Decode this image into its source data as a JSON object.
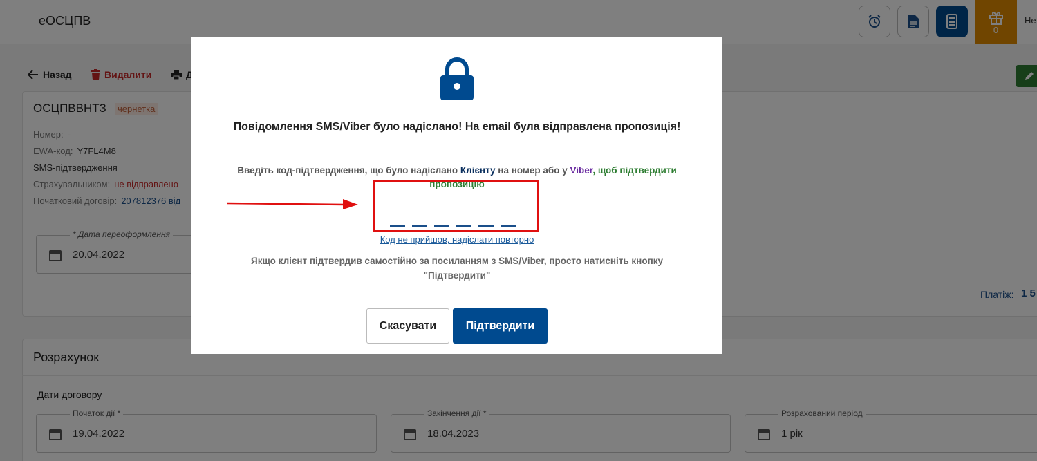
{
  "header": {
    "app_title": "еОСЦПВ",
    "gift_count": "0",
    "user_text": "Не"
  },
  "toolbar": {
    "back": "Назад",
    "delete": "Видалити",
    "print": "Д"
  },
  "document": {
    "title": "ОСЦПВВНТЗ",
    "status": "чернетка",
    "number_label": "Номер:",
    "number_value": "-",
    "ewa_label": "EWA-код:",
    "ewa_value": "Y7FL4M8",
    "sms_label": "SMS-підтвердження",
    "insurer_label": "Страхувальником:",
    "insurer_value": "не відправлено",
    "original_label": "Початковий договір:",
    "original_value": "207812376 від"
  },
  "reissue": {
    "label": "* Дата переоформлення",
    "value": "20.04.2022"
  },
  "payment": {
    "label": "Платіж:",
    "value": "1 5"
  },
  "calculation": {
    "title": "Розрахунок",
    "dates_label": "Дати договору",
    "start": {
      "label": "Початок дії *",
      "value": "19.04.2022"
    },
    "end": {
      "label": "Закінчення дії *",
      "value": "18.04.2023"
    },
    "period": {
      "label": "Розрахований період",
      "value": "1 рік"
    }
  },
  "modal": {
    "title": "Повідомлення SMS/Viber було надіслано! На email була відправлена пропозиція!",
    "instr_part1": "Введіть код-підтвердження, що було надіслано ",
    "instr_client": "Клієнту",
    "instr_part2": " на номер або у ",
    "instr_viber": "Viber",
    "instr_part3": ", щоб підтвердити пропозицію",
    "resend": "Код не прийшов, надіслати повторно",
    "hint": "Якщо клієнт підтвердив самостійно за посиланням з SMS/Viber, просто натисніть кнопку \"Підтвердити\"",
    "cancel": "Скасувати",
    "confirm": "Підтвердити"
  },
  "colors": {
    "primary": "#004a8f",
    "accent_orange": "#e08a00",
    "danger": "#c62828",
    "success": "#2e7d32",
    "highlight": "#e01010"
  },
  "icons": [
    "alarm-clock-icon",
    "document-icon",
    "calculator-icon",
    "gift-icon",
    "arrow-left-icon",
    "trash-icon",
    "printer-icon",
    "pencil-icon",
    "calendar-icon",
    "lock-icon"
  ]
}
